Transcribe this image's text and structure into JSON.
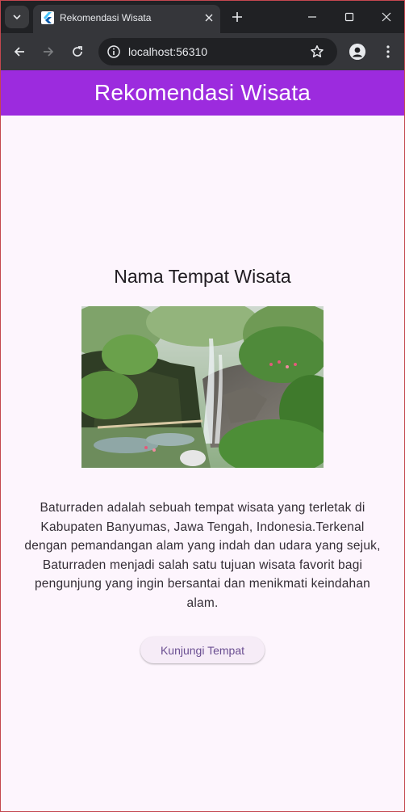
{
  "browser": {
    "tab_title": "Rekomendasi Wisata",
    "url": "localhost:56310"
  },
  "app": {
    "title": "Rekomendasi Wisata"
  },
  "place": {
    "name": "Nama Tempat Wisata",
    "description": "Baturraden adalah sebuah tempat wisata yang terletak di Kabupaten Banyumas, Jawa Tengah, Indonesia.Terkenal dengan pemandangan alam yang indah dan udara yang sejuk, Baturraden menjadi salah satu tujuan wisata favorit bagi pengunjung yang ingin bersantai dan menikmati keindahan alam.",
    "visit_button": "Kunjungi Tempat"
  },
  "colors": {
    "appbar": "#9c2bde",
    "background": "#fdf5fd",
    "button_text": "#6a4e91"
  }
}
